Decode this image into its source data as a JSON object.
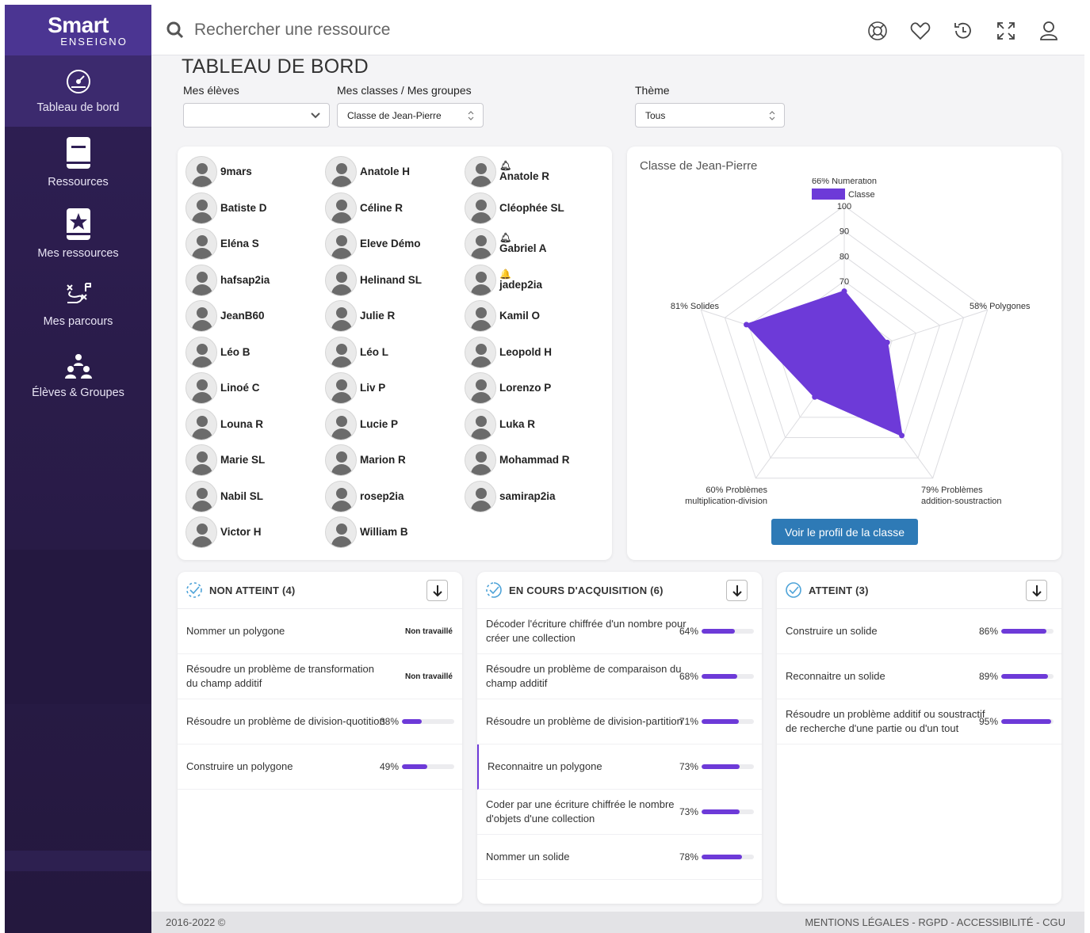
{
  "brand": {
    "line1": "Smart",
    "line2": "ENSEIGNO"
  },
  "nav": [
    {
      "label": "Tableau de bord",
      "icon": "gauge-icon"
    },
    {
      "label": "Ressources",
      "icon": "book-icon"
    },
    {
      "label": "Mes ressources",
      "icon": "star-book-icon"
    },
    {
      "label": "Mes parcours",
      "icon": "route-icon"
    },
    {
      "label": "Élèves & Groupes",
      "icon": "group-icon"
    }
  ],
  "search": {
    "placeholder": "Rechercher une ressource"
  },
  "top_icons": [
    "help-lifebuoy-icon",
    "favorites-heart-icon",
    "history-icon",
    "fullscreen-icon",
    "user-icon"
  ],
  "page_title": "TABLEAU DE BORD",
  "filters": {
    "eleves_label": "Mes élèves",
    "eleves_value": "",
    "classes_label": "Mes classes / Mes groupes",
    "classes_value": "Classe de Jean-Pierre",
    "theme_label": "Thème",
    "theme_value": "Tous"
  },
  "students": [
    {
      "name": "9mars"
    },
    {
      "name": "Anatole H"
    },
    {
      "name": "Anatole R",
      "bell": "outline"
    },
    {
      "name": "Batiste D"
    },
    {
      "name": "Céline R"
    },
    {
      "name": "Cléophée SL"
    },
    {
      "name": "Eléna S"
    },
    {
      "name": "Eleve Démo"
    },
    {
      "name": "Gabriel A",
      "bell": "outline"
    },
    {
      "name": "hafsap2ia"
    },
    {
      "name": "Helinand SL"
    },
    {
      "name": "jadep2ia",
      "bell": "filled"
    },
    {
      "name": "JeanB60"
    },
    {
      "name": "Julie R"
    },
    {
      "name": "Kamil O"
    },
    {
      "name": "Léo B"
    },
    {
      "name": "Léo L"
    },
    {
      "name": "Leopold H"
    },
    {
      "name": "Linoé C"
    },
    {
      "name": "Liv P"
    },
    {
      "name": "Lorenzo P"
    },
    {
      "name": "Louna R"
    },
    {
      "name": "Lucie P"
    },
    {
      "name": "Luka R"
    },
    {
      "name": "Marie SL"
    },
    {
      "name": "Marion R"
    },
    {
      "name": "Mohammad R"
    },
    {
      "name": "Nabil SL"
    },
    {
      "name": "rosep2ia"
    },
    {
      "name": "samirap2ia"
    },
    {
      "name": "Victor H"
    },
    {
      "name": "William B"
    }
  ],
  "bell_glyphs": {
    "outline": "🔔︎",
    "filled": "🔔"
  },
  "class_panel": {
    "title": "Classe de Jean-Pierre",
    "button": "Voir le profil de la classe"
  },
  "chart_data": {
    "type": "radar",
    "title": "",
    "legend": [
      "Classe"
    ],
    "legend_position": "top",
    "color": "#6d3ad8",
    "axis_ticks": [
      "70",
      "80",
      "90",
      "100"
    ],
    "rlim": [
      40,
      100
    ],
    "axes": [
      {
        "label_lines": [
          "66% Numération"
        ],
        "value": 66
      },
      {
        "label_lines": [
          "58% Polygones"
        ],
        "value": 58
      },
      {
        "label_lines": [
          "79% Problèmes",
          "addition-soustraction"
        ],
        "value": 79
      },
      {
        "label_lines": [
          "60% Problèmes",
          "multiplication-division"
        ],
        "value": 60
      },
      {
        "label_lines": [
          "81% Solides"
        ],
        "value": 81
      }
    ]
  },
  "columns": [
    {
      "title": "NON ATTEINT (4)",
      "icon": "dashed-check-circle-icon",
      "rows": [
        {
          "text": "Nommer un polygone",
          "status": "Non travaillé"
        },
        {
          "text": "Résoudre un problème de transformation du champ additif",
          "status": "Non travaillé"
        },
        {
          "text": "Résoudre un problème de division-quotition",
          "pct": "38%",
          "value": 38
        },
        {
          "text": "Construire un polygone",
          "pct": "49%",
          "value": 49
        }
      ]
    },
    {
      "title": "EN COURS D'ACQUISITION (6)",
      "icon": "half-check-circle-icon",
      "rows": [
        {
          "text": "Décoder l'écriture chiffrée d'un nombre pour créer une collection",
          "pct": "64%",
          "value": 64
        },
        {
          "text": "Résoudre un problème de comparaison du champ additif",
          "pct": "68%",
          "value": 68
        },
        {
          "text": "Résoudre un problème de division-partition",
          "pct": "71%",
          "value": 71
        },
        {
          "text": "Reconnaitre un polygone",
          "pct": "73%",
          "value": 73,
          "selected": true
        },
        {
          "text": "Coder par une écriture chiffrée le nombre d'objets d'une collection",
          "pct": "73%",
          "value": 73
        },
        {
          "text": "Nommer un solide",
          "pct": "78%",
          "value": 78
        }
      ]
    },
    {
      "title": "ATTEINT (3)",
      "icon": "check-circle-icon",
      "rows": [
        {
          "text": "Construire un solide",
          "pct": "86%",
          "value": 86
        },
        {
          "text": "Reconnaitre un solide",
          "pct": "89%",
          "value": 89
        },
        {
          "text": "Résoudre un problème additif ou soustractif de recherche d'une partie ou d'un tout",
          "pct": "95%",
          "value": 95
        }
      ]
    }
  ],
  "footer": {
    "left": "2016-2022 ©",
    "right": "MENTIONS LÉGALES - RGPD - ACCESSIBILITÉ - CGU"
  }
}
